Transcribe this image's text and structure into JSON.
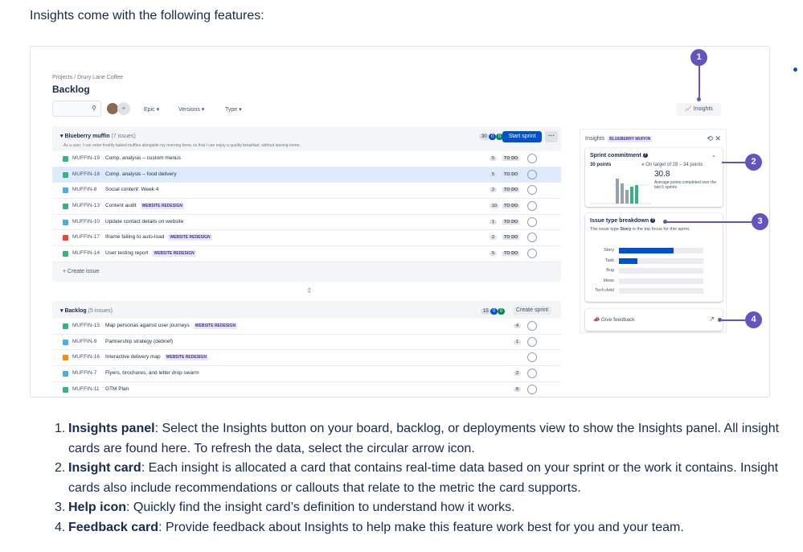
{
  "intro": "Insights come with the following features:",
  "backlog_ui": {
    "breadcrumb": "Projects  /  Drury Lane Coffee",
    "title": "Backlog",
    "filters": [
      "Epic",
      "Versions",
      "Type"
    ],
    "insights_button": "Insights",
    "sprint": {
      "name": "Blueberry muffin",
      "count": "(7 issues)",
      "description": "As a user, I can order freshly baked muffins alongside my morning brew, so that I can enjoy a quality breakfast, without leaving home.",
      "counts": [
        "30",
        "0",
        "0"
      ],
      "start_button": "Start sprint",
      "more": "···",
      "issues": [
        {
          "key": "MUFFIN-19",
          "summary": "Comp. analysis – custom menus",
          "epic": "",
          "est": "5",
          "status": "TO DO",
          "type": "story"
        },
        {
          "key": "MUFFIN-18",
          "summary": "Comp. analysis – food delivery",
          "epic": "",
          "est": "5",
          "status": "TO DO",
          "type": "story"
        },
        {
          "key": "MUFFIN-8",
          "summary": "Social content: Week 4",
          "epic": "",
          "est": "2",
          "status": "TO DO",
          "type": "task"
        },
        {
          "key": "MUFFIN-13",
          "summary": "Content audit",
          "epic": "WEBSITE REDESIGN",
          "est": "10",
          "status": "TO DO",
          "type": "story"
        },
        {
          "key": "MUFFIN-10",
          "summary": "Update contact details on website",
          "epic": "",
          "est": "1",
          "status": "TO DO",
          "type": "task"
        },
        {
          "key": "MUFFIN-17",
          "summary": "Iframe failing to auto-load",
          "epic": "WEBSITE REDESIGN",
          "est": "2",
          "status": "TO DO",
          "type": "bug"
        },
        {
          "key": "MUFFIN-14",
          "summary": "User testing report",
          "epic": "WEBSITE REDESIGN",
          "est": "5",
          "status": "TO DO",
          "type": "story"
        }
      ],
      "create_issue": "+ Create issue"
    },
    "backlog": {
      "name": "Backlog",
      "count": "(5 issues)",
      "counts": [
        "15",
        "0",
        "0"
      ],
      "create_sprint": "Create sprint",
      "issues": [
        {
          "key": "MUFFIN-15",
          "summary": "Map personas against user journeys",
          "epic": "WEBSITE REDESIGN",
          "est": "4",
          "type": "story"
        },
        {
          "key": "MUFFIN-9",
          "summary": "Partnership strategy (debrief)",
          "epic": "",
          "est": "1",
          "type": "task"
        },
        {
          "key": "MUFFIN-16",
          "summary": "Interactive delivery map",
          "epic": "WEBSITE REDESIGN",
          "est": "",
          "type": "improvement"
        },
        {
          "key": "MUFFIN-7",
          "summary": "Flyers, brochures, and letter drop swarm",
          "epic": "",
          "est": "2",
          "type": "task"
        },
        {
          "key": "MUFFIN-11",
          "summary": "GTM Plan",
          "epic": "",
          "est": "8",
          "type": "story"
        }
      ]
    },
    "insights_panel": {
      "title": "Insights",
      "tag": "BLUEBERRY MUFFIN",
      "icons": "⟲ ✕",
      "commitment": {
        "title": "Sprint commitment",
        "points": "30 points",
        "status": "On target of 28 – 34 points",
        "avg": "30.8",
        "avg_label": "Average points completed over the last 5 sprints"
      },
      "breakdown": {
        "title": "Issue type breakdown",
        "text_before": "The issue type",
        "text_bold": "Story",
        "text_after": "is the top focus for this sprint.",
        "bars": [
          {
            "label": "Story",
            "value": 0.65
          },
          {
            "label": "Task",
            "value": 0.22
          },
          {
            "label": "Bug",
            "value": 0
          },
          {
            "label": "Ideas",
            "value": 0
          },
          {
            "label": "Tech debt",
            "value": 0
          }
        ]
      },
      "feedback": "Give feedback"
    },
    "callouts": [
      "1",
      "2",
      "3",
      "4"
    ]
  },
  "features": [
    {
      "num": "1.",
      "title": "Insights panel",
      "text": ": Select the Insights button on your board, backlog, or deployments view to show the Insights panel. All insight cards are found here. To refresh the data, select the circular arrow icon."
    },
    {
      "num": "2.",
      "title": "Insight card",
      "text": ": Each insight is allocated a card that contains real-time data based on your sprint or the work it contains. Insight cards also include recommendations or callouts that relate to the metric the card supports."
    },
    {
      "num": "3.",
      "title": "Help icon",
      "text": ": Quickly find the insight card’s definition to understand how it works."
    },
    {
      "num": "4.",
      "title": "Feedback card",
      "text": ": Provide feedback about Insights to help make this feature work best for you and your team."
    }
  ],
  "colors": {
    "accent": "#0052cc",
    "callout": "#6554c0",
    "story": "#36b37e",
    "task": "#4bade8",
    "bug": "#e5493a",
    "improvement": "#ff8b00"
  }
}
